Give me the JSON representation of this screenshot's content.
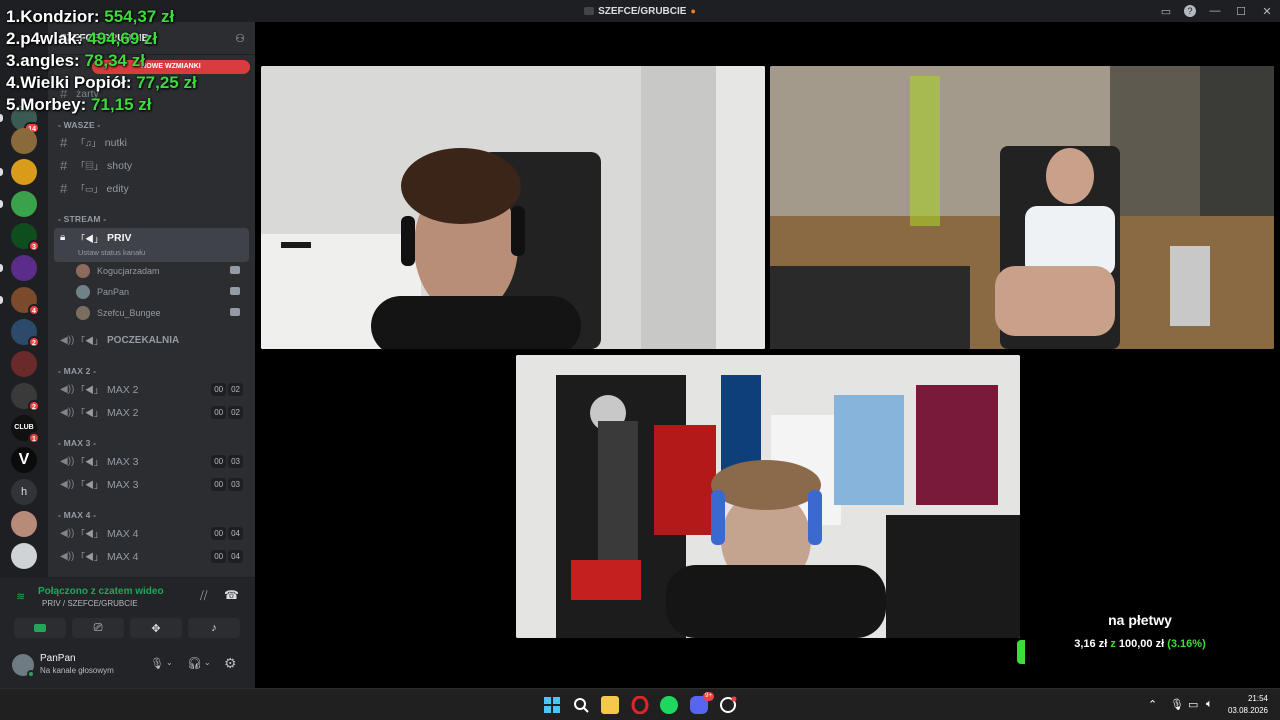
{
  "window": {
    "title": "SZEFCE/GRUBCIE"
  },
  "leaderboard": [
    {
      "rank": "1.",
      "name": "Kondzior:",
      "amount": "554,37 zł"
    },
    {
      "rank": "2.",
      "name": "p4wlak:",
      "amount": "494,69 zł"
    },
    {
      "rank": "3.",
      "name": "angles:",
      "amount": "78,34 zł"
    },
    {
      "rank": "4.",
      "name": "Wielki Popiół:",
      "amount": "77,25 zł"
    },
    {
      "rank": "5.",
      "name": "Morbey:",
      "amount": "71,15 zł"
    }
  ],
  "server": {
    "name": "SZEFCE/GRUBCIE",
    "new_mentions": "NOWE WZMIANKI"
  },
  "server_badges": [
    "14",
    "3",
    "4",
    "2",
    "2",
    "1"
  ],
  "server_letter": "h",
  "server_club_text": "CLUB",
  "channels": {
    "top_channel": "żarty",
    "cat_wasze": "- WASZE -",
    "wasze": [
      "nutki",
      "shoty",
      "edity"
    ],
    "cat_stream": "- STREAM -",
    "priv": "PRIV",
    "priv_status": "Ustaw status kanału",
    "voice_users": [
      "Kogucjarzadam",
      "PanPan",
      "Szefcu_Bungee"
    ],
    "poczekalnia": "POCZEKALNIA",
    "cat_max2": "- MAX 2 -",
    "max2": [
      "MAX 2",
      "MAX 2"
    ],
    "max2_counts": [
      "00",
      "02"
    ],
    "cat_max3": "- MAX 3 -",
    "max3": [
      "MAX 3",
      "MAX 3"
    ],
    "max3_counts": [
      "00",
      "03"
    ],
    "cat_max4": "- MAX 4 -",
    "max4": [
      "MAX 4",
      "MAX 4"
    ],
    "max4_counts": [
      "00",
      "04"
    ]
  },
  "voice_panel": {
    "status": "Połączono z czatem wideo",
    "channel": "PRIV / SZEFCE/GRUBCIE"
  },
  "user": {
    "name": "PanPan",
    "status": "Na kanale głosowym"
  },
  "donation": {
    "message": "na płetwy",
    "current": "3,16 zł",
    "separator": "z",
    "goal": "100,00 zł",
    "percent": "(3.16%)",
    "progress_fraction": 0.0316
  },
  "taskbar": {
    "time": "21:54",
    "date": "03.08.2026",
    "discord_badge": "9+"
  },
  "colors": {
    "accent_green": "#3ddc3d",
    "mention_red": "#d83c3e",
    "voice_green": "#23a55a"
  }
}
